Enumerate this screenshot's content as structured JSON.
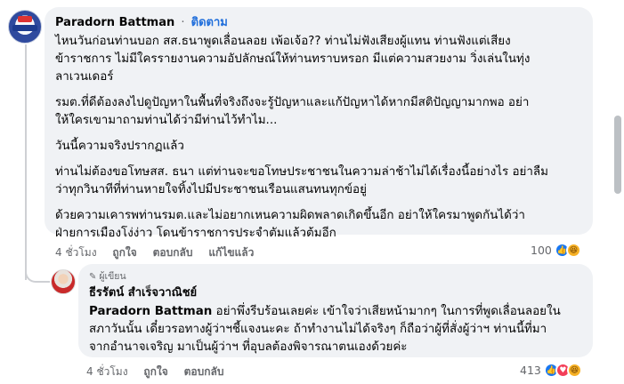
{
  "comment": {
    "author": "Paradorn Battman",
    "separator": "·",
    "follow_label": "ติดตาม",
    "paragraphs": [
      [
        "ไหนวันก่อนท่านบอก สส.ธนาพูดเลื่อนลอย เพ้อเจ้อ?? ท่านไม่ฟังเสียงผู้แทน ท่านฟังแต่เสียง",
        "ข้าราชการ  ไม่มีใครรายงานความอัปลักษณ์ให้ท่านทราบหรอก มีแต่ความสวยงาม วิ่งเล่นในทุ่ง",
        "ลาเวนเดอร์"
      ],
      [
        "รมต.ที่ดีต้องลงไปดูปัญหาในพื้นที่จริงถึงจะรู้ปัญหาและแก้ปัญหาได้หากมีสติปัญญามากพอ อย่า",
        "ให้ใครเขามาถามท่านได้ว่ามีท่านไว้ทำไม..."
      ],
      [
        "วันนี้ความจริงปรากฏแล้ว"
      ],
      [
        "ท่านไม่ต้องขอโทษสส. ธนา แต่ท่านจะขอโทษประชาชนในความล่าช้าไม่ได้เรื่องนี้อย่างไร อย่าลืม",
        "ว่าทุกวินาทีที่ท่านหายใจทิ้งไปมีประชาชนเรือนแสนทนทุกข์อยู่"
      ],
      [
        "ด้วยความเคารพท่านรมต.และไม่อยากเหนความผิดพลาดเกิดขึ้นอีก อย่าให้ใครมาพูดกันได้ว่า",
        "ฝ่ายการเมืองโง่ง่าว โดนข้าราชการประจำตัมแล้วต้มอีก"
      ]
    ],
    "time": "4 ชั่วโมง",
    "like_label": "ถูกใจ",
    "reply_label": "ตอบกลับ",
    "edited_label": "แก้ไขแล้ว",
    "reaction_count": "100",
    "reactions": [
      "like",
      "haha"
    ]
  },
  "reply": {
    "badge_icon": "pen-icon",
    "badge": "ผู้เขียน",
    "author": "ธีรรัตน์ สำเร็จวาณิชย์",
    "mention": "Paradorn Battman",
    "lines": [
      " อย่าพึ่งรีบร้อนเลยค่ะ เข้าใจว่าเสียหน้ามากๆ ในการที่พูดเลื่อนลอยใน",
      "สภาวันนั้น เดี๋ยวรอทางผู้ว่าฯชี้แจงนะคะ ถ้าทำงานไม่ได้จริงๆ ก็ถือว่าผู้ที่สั่งผู้ว่าฯ ท่านนี้ที่มา",
      "จากอำนาจเจริญ มาเป็นผู้ว่าฯ ที่อุบลต้องพิจารณาตนเองด้วยค่ะ"
    ],
    "time": "4 ชั่วโมง",
    "like_label": "ถูกใจ",
    "reply_label": "ตอบกลับ",
    "reaction_count": "413",
    "reactions": [
      "like",
      "love",
      "haha"
    ]
  },
  "colors": {
    "bubble": "#f0f2f5",
    "link": "#216fdb",
    "meta": "#65676b",
    "like": "#1877f2",
    "love": "#f33e58",
    "haha": "#f7b125"
  }
}
